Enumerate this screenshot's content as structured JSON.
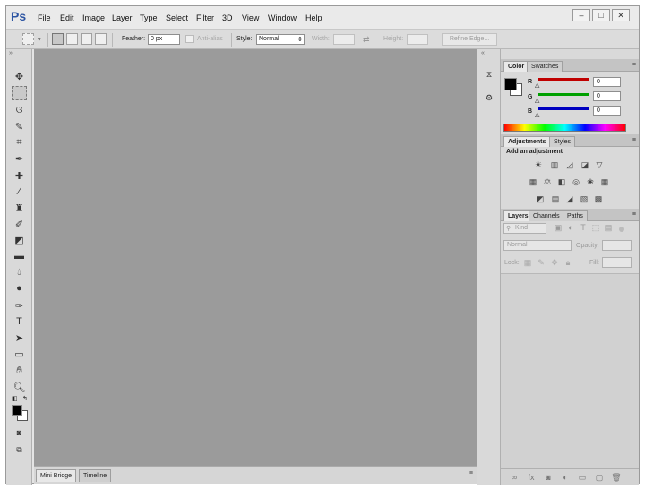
{
  "app": {
    "logo": "Ps"
  },
  "menu": [
    "File",
    "Edit",
    "Image",
    "Layer",
    "Type",
    "Select",
    "Filter",
    "3D",
    "View",
    "Window",
    "Help"
  ],
  "window_controls": {
    "minimize": "–",
    "maximize": "□",
    "close": "✕"
  },
  "options_bar": {
    "feather_label": "Feather:",
    "feather_value": "0 px",
    "anti_alias_label": "Anti-alias",
    "style_label": "Style:",
    "style_value": "Normal",
    "width_label": "Width:",
    "height_label": "Height:",
    "refine_label": "Refine Edge..."
  },
  "bottom_tabs": [
    "Mini Bridge",
    "Timeline"
  ],
  "color_panel": {
    "tabs": [
      "Color",
      "Swatches"
    ],
    "channels": [
      {
        "label": "R",
        "value": "0",
        "color": "#c00000"
      },
      {
        "label": "G",
        "value": "0",
        "color": "#00a000"
      },
      {
        "label": "B",
        "value": "0",
        "color": "#0000c0"
      }
    ]
  },
  "adjustments_panel": {
    "tabs": [
      "Adjustments",
      "Styles"
    ],
    "title": "Add an adjustment"
  },
  "layers_panel": {
    "tabs": [
      "Layers",
      "Channels",
      "Paths"
    ],
    "kind_label": "Kind",
    "blend_mode": "Normal",
    "opacity_label": "Opacity:",
    "lock_label": "Lock:",
    "fill_label": "Fill:"
  }
}
